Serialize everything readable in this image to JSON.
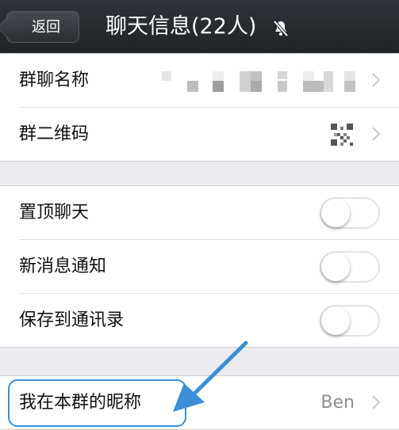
{
  "navbar": {
    "back_label": "返回",
    "title": "聊天信息(22人)",
    "mute_icon": "bell-slash-icon"
  },
  "section1": [
    {
      "label": "群聊名称",
      "value_type": "pixelated-name"
    },
    {
      "label": "群二维码",
      "value_type": "qr-icon"
    }
  ],
  "section2": [
    {
      "label": "置顶聊天",
      "toggle": false
    },
    {
      "label": "新消息通知",
      "toggle": false
    },
    {
      "label": "保存到通讯录",
      "toggle": false
    }
  ],
  "section3": [
    {
      "label": "我在本群的昵称",
      "value": "Ben"
    }
  ],
  "colors": {
    "navbar": "#22272c",
    "background": "#ebebf0",
    "highlight": "#3a8fd8",
    "secondary_text": "#8e8e93"
  }
}
